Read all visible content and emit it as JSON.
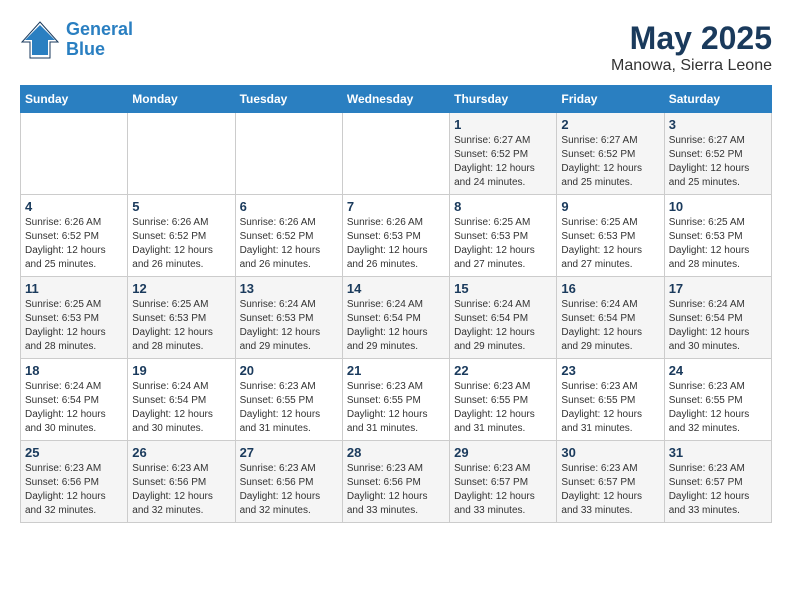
{
  "header": {
    "logo_line1": "General",
    "logo_line2": "Blue",
    "month_year": "May 2025",
    "location": "Manowa, Sierra Leone"
  },
  "weekdays": [
    "Sunday",
    "Monday",
    "Tuesday",
    "Wednesday",
    "Thursday",
    "Friday",
    "Saturday"
  ],
  "weeks": [
    [
      {
        "day": "",
        "info": ""
      },
      {
        "day": "",
        "info": ""
      },
      {
        "day": "",
        "info": ""
      },
      {
        "day": "",
        "info": ""
      },
      {
        "day": "1",
        "info": "Sunrise: 6:27 AM\nSunset: 6:52 PM\nDaylight: 12 hours and 24 minutes."
      },
      {
        "day": "2",
        "info": "Sunrise: 6:27 AM\nSunset: 6:52 PM\nDaylight: 12 hours and 25 minutes."
      },
      {
        "day": "3",
        "info": "Sunrise: 6:27 AM\nSunset: 6:52 PM\nDaylight: 12 hours and 25 minutes."
      }
    ],
    [
      {
        "day": "4",
        "info": "Sunrise: 6:26 AM\nSunset: 6:52 PM\nDaylight: 12 hours and 25 minutes."
      },
      {
        "day": "5",
        "info": "Sunrise: 6:26 AM\nSunset: 6:52 PM\nDaylight: 12 hours and 26 minutes."
      },
      {
        "day": "6",
        "info": "Sunrise: 6:26 AM\nSunset: 6:52 PM\nDaylight: 12 hours and 26 minutes."
      },
      {
        "day": "7",
        "info": "Sunrise: 6:26 AM\nSunset: 6:53 PM\nDaylight: 12 hours and 26 minutes."
      },
      {
        "day": "8",
        "info": "Sunrise: 6:25 AM\nSunset: 6:53 PM\nDaylight: 12 hours and 27 minutes."
      },
      {
        "day": "9",
        "info": "Sunrise: 6:25 AM\nSunset: 6:53 PM\nDaylight: 12 hours and 27 minutes."
      },
      {
        "day": "10",
        "info": "Sunrise: 6:25 AM\nSunset: 6:53 PM\nDaylight: 12 hours and 28 minutes."
      }
    ],
    [
      {
        "day": "11",
        "info": "Sunrise: 6:25 AM\nSunset: 6:53 PM\nDaylight: 12 hours and 28 minutes."
      },
      {
        "day": "12",
        "info": "Sunrise: 6:25 AM\nSunset: 6:53 PM\nDaylight: 12 hours and 28 minutes."
      },
      {
        "day": "13",
        "info": "Sunrise: 6:24 AM\nSunset: 6:53 PM\nDaylight: 12 hours and 29 minutes."
      },
      {
        "day": "14",
        "info": "Sunrise: 6:24 AM\nSunset: 6:54 PM\nDaylight: 12 hours and 29 minutes."
      },
      {
        "day": "15",
        "info": "Sunrise: 6:24 AM\nSunset: 6:54 PM\nDaylight: 12 hours and 29 minutes."
      },
      {
        "day": "16",
        "info": "Sunrise: 6:24 AM\nSunset: 6:54 PM\nDaylight: 12 hours and 29 minutes."
      },
      {
        "day": "17",
        "info": "Sunrise: 6:24 AM\nSunset: 6:54 PM\nDaylight: 12 hours and 30 minutes."
      }
    ],
    [
      {
        "day": "18",
        "info": "Sunrise: 6:24 AM\nSunset: 6:54 PM\nDaylight: 12 hours and 30 minutes."
      },
      {
        "day": "19",
        "info": "Sunrise: 6:24 AM\nSunset: 6:54 PM\nDaylight: 12 hours and 30 minutes."
      },
      {
        "day": "20",
        "info": "Sunrise: 6:23 AM\nSunset: 6:55 PM\nDaylight: 12 hours and 31 minutes."
      },
      {
        "day": "21",
        "info": "Sunrise: 6:23 AM\nSunset: 6:55 PM\nDaylight: 12 hours and 31 minutes."
      },
      {
        "day": "22",
        "info": "Sunrise: 6:23 AM\nSunset: 6:55 PM\nDaylight: 12 hours and 31 minutes."
      },
      {
        "day": "23",
        "info": "Sunrise: 6:23 AM\nSunset: 6:55 PM\nDaylight: 12 hours and 31 minutes."
      },
      {
        "day": "24",
        "info": "Sunrise: 6:23 AM\nSunset: 6:55 PM\nDaylight: 12 hours and 32 minutes."
      }
    ],
    [
      {
        "day": "25",
        "info": "Sunrise: 6:23 AM\nSunset: 6:56 PM\nDaylight: 12 hours and 32 minutes."
      },
      {
        "day": "26",
        "info": "Sunrise: 6:23 AM\nSunset: 6:56 PM\nDaylight: 12 hours and 32 minutes."
      },
      {
        "day": "27",
        "info": "Sunrise: 6:23 AM\nSunset: 6:56 PM\nDaylight: 12 hours and 32 minutes."
      },
      {
        "day": "28",
        "info": "Sunrise: 6:23 AM\nSunset: 6:56 PM\nDaylight: 12 hours and 33 minutes."
      },
      {
        "day": "29",
        "info": "Sunrise: 6:23 AM\nSunset: 6:57 PM\nDaylight: 12 hours and 33 minutes."
      },
      {
        "day": "30",
        "info": "Sunrise: 6:23 AM\nSunset: 6:57 PM\nDaylight: 12 hours and 33 minutes."
      },
      {
        "day": "31",
        "info": "Sunrise: 6:23 AM\nSunset: 6:57 PM\nDaylight: 12 hours and 33 minutes."
      }
    ]
  ]
}
